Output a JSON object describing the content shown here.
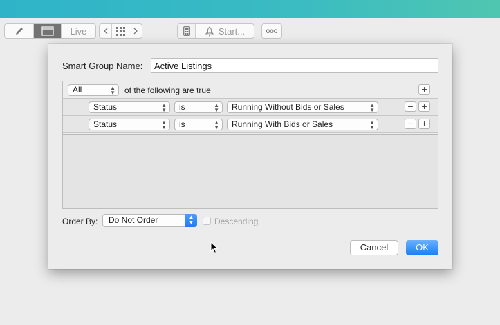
{
  "toolbar": {
    "live_label": "Live",
    "start_label": "Start...",
    "more_label": "ooo"
  },
  "dialog": {
    "name_label": "Smart Group Name:",
    "name_value": "Active Listings",
    "match_value": "All",
    "match_suffix": "of the following are true",
    "rules": [
      {
        "field": "Status",
        "operator": "is",
        "value": "Running Without Bids or Sales"
      },
      {
        "field": "Status",
        "operator": "is",
        "value": "Running With Bids or Sales"
      }
    ],
    "order_label": "Order By:",
    "order_value": "Do Not Order",
    "descending_label": "Descending",
    "cancel_label": "Cancel",
    "ok_label": "OK"
  },
  "colors": {
    "accent": "#1a7ef5",
    "titlebar": "#3bbcc2"
  }
}
